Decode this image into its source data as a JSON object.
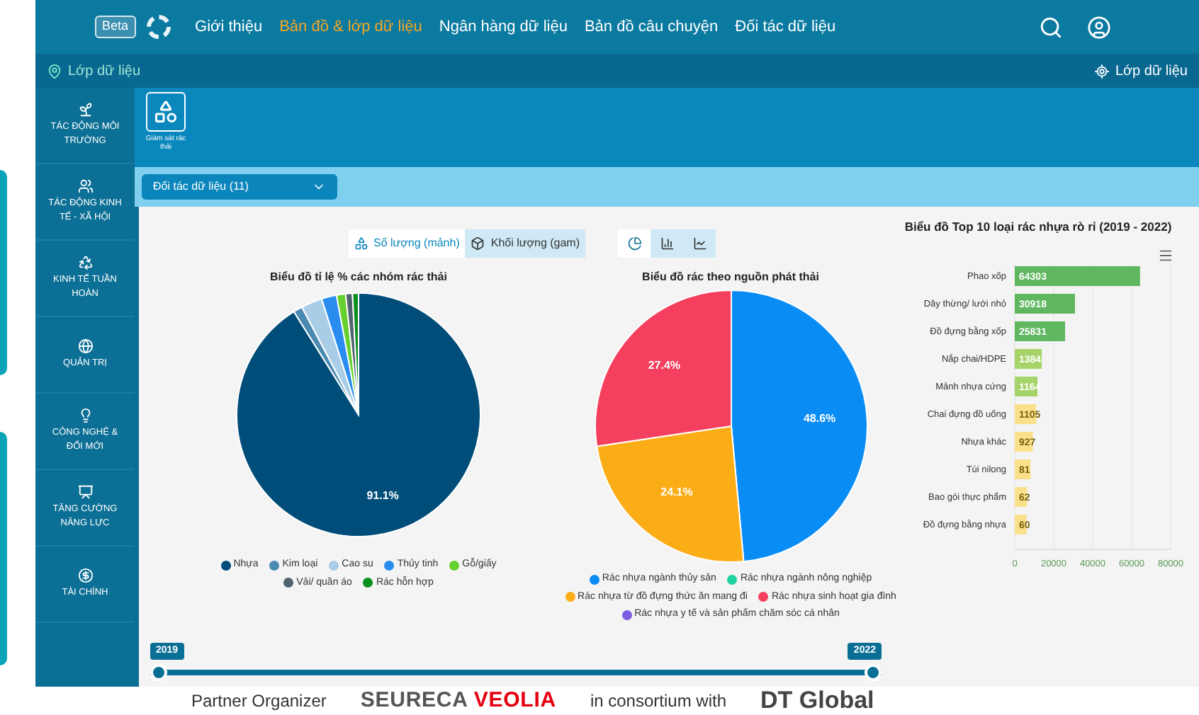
{
  "header": {
    "badge": "Beta",
    "nav": [
      {
        "label": "Giới thiệu",
        "selected": false
      },
      {
        "label": "Bản đồ & lớp dữ liệu",
        "selected": true
      },
      {
        "label": "Ngân hàng dữ liệu",
        "selected": false
      },
      {
        "label": "Bản đồ câu chuyện",
        "selected": false
      },
      {
        "label": "Đối tác dữ liệu",
        "selected": false
      }
    ]
  },
  "layer_bar": {
    "left": "Lớp dữ liệu",
    "right": "Lớp dữ liệu"
  },
  "sidebar": {
    "items": [
      {
        "label": "TÁC ĐỘNG MÔI TRƯỜNG",
        "kind": "leaf"
      },
      {
        "label": "TÁC ĐỘNG KINH TẾ - XÃ HỘI",
        "kind": "people"
      },
      {
        "label": "KINH TẾ TUẦN HOÀN",
        "kind": "cycle"
      },
      {
        "label": "QUẢN TRỊ",
        "kind": "globe"
      },
      {
        "label": "CÔNG NGHỆ & ĐỔI MỚI",
        "kind": "bulb"
      },
      {
        "label": "TĂNG CƯỜNG NĂNG LỰC",
        "kind": "training"
      },
      {
        "label": "TÀI CHÍNH",
        "kind": "money"
      }
    ]
  },
  "modules": [
    {
      "label": "Giám sát rác thải",
      "selected": true
    }
  ],
  "filter": {
    "dropdown": "Đối tác dữ liệu (11)"
  },
  "measure_toggle": [
    {
      "label": "Số lượng (mảnh)",
      "selected": true
    },
    {
      "label": "Khối lượng (gam)",
      "selected": false
    }
  ],
  "chart_type_toggle": [
    {
      "kind": "pie",
      "selected": true
    },
    {
      "kind": "bar",
      "selected": false
    },
    {
      "kind": "line",
      "selected": false
    }
  ],
  "pie_groups": {
    "chart_data": {
      "type": "pie",
      "title": "Biểu đồ tỉ lệ % các nhóm rác thải",
      "categories": [
        "Nhựa",
        "Kim loại",
        "Cao su",
        "Thủy tinh",
        "Gỗ/giấy",
        "Vải/ quần áo",
        "Rác hỗn hợp"
      ],
      "series": [
        {
          "colors": [
            "#004d7a",
            "#4a89b0",
            "#a9cde6",
            "#2b8cf0",
            "#66d12e",
            "#51626f",
            "#0b8f1e"
          ],
          "values": [
            91.1,
            1.2,
            2.8,
            2.0,
            1.2,
            0.9,
            0.8
          ]
        }
      ],
      "value_labels": [
        "91.1%",
        null,
        null,
        null,
        null,
        null,
        null
      ]
    }
  },
  "pie_sources": {
    "chart_data": {
      "type": "pie",
      "title": "Biểu đồ rác theo nguồn phát thải",
      "categories": [
        "Rác nhựa ngành thủy sản",
        "Rác nhựa ngành nông nghiệp",
        "Rác nhựa từ đồ đựng thức ăn mang đi",
        "Rác nhựa sinh hoạt gia đình",
        "Rác nhựa y tế và sản phẩm chăm sóc cá nhân"
      ],
      "series": [
        {
          "colors": [
            "#0a8cf5",
            "#22d3a0",
            "#fbad18",
            "#f43f5e",
            "#7c5ce0"
          ],
          "values": [
            48.6,
            0,
            24.1,
            27.4,
            0
          ]
        }
      ],
      "value_labels": [
        "48.6%",
        null,
        "24.1%",
        "27.4%",
        null
      ]
    }
  },
  "top10": {
    "chart_data": {
      "type": "bar",
      "orientation": "horizontal",
      "title": "Biểu đồ Top 10 loại rác nhựa rò rỉ (2019 - 2022)",
      "categories": [
        "Phao xốp",
        "Dây thừng/ lưới nhỏ",
        "Đồ đựng bằng xốp",
        "Nắp chai/HDPE",
        "Mảnh nhựa cứng",
        "Chai đựng đồ uống",
        "Nhựa khác",
        "Túi nilong",
        "Bao gói thực phẩm",
        "Đồ đựng bằng nhựa"
      ],
      "grid": true,
      "series": [
        {
          "values": [
            64303,
            30918,
            25831,
            13840,
            11640,
            11050,
            9271,
            8110,
            6250,
            6000
          ]
        }
      ],
      "value_labels": [
        "64303",
        "30918",
        "25831",
        "1384",
        "1164",
        "1105",
        "927",
        "81",
        "62",
        "60"
      ],
      "xlim": [
        0,
        80000
      ],
      "xticks": [
        0,
        20000,
        40000,
        60000,
        80000
      ]
    }
  },
  "timeline": {
    "start": "2019",
    "end": "2022",
    "start_handle": {
      "level": 0
    },
    "end_handle": {
      "level": 1
    }
  },
  "footer": {
    "partner_label": "Partner Organizer",
    "logo_1": "SEURECA",
    "logo_2": "VEOLIA",
    "consortium_label": "in consortium with",
    "logo_3": "DT Global"
  }
}
